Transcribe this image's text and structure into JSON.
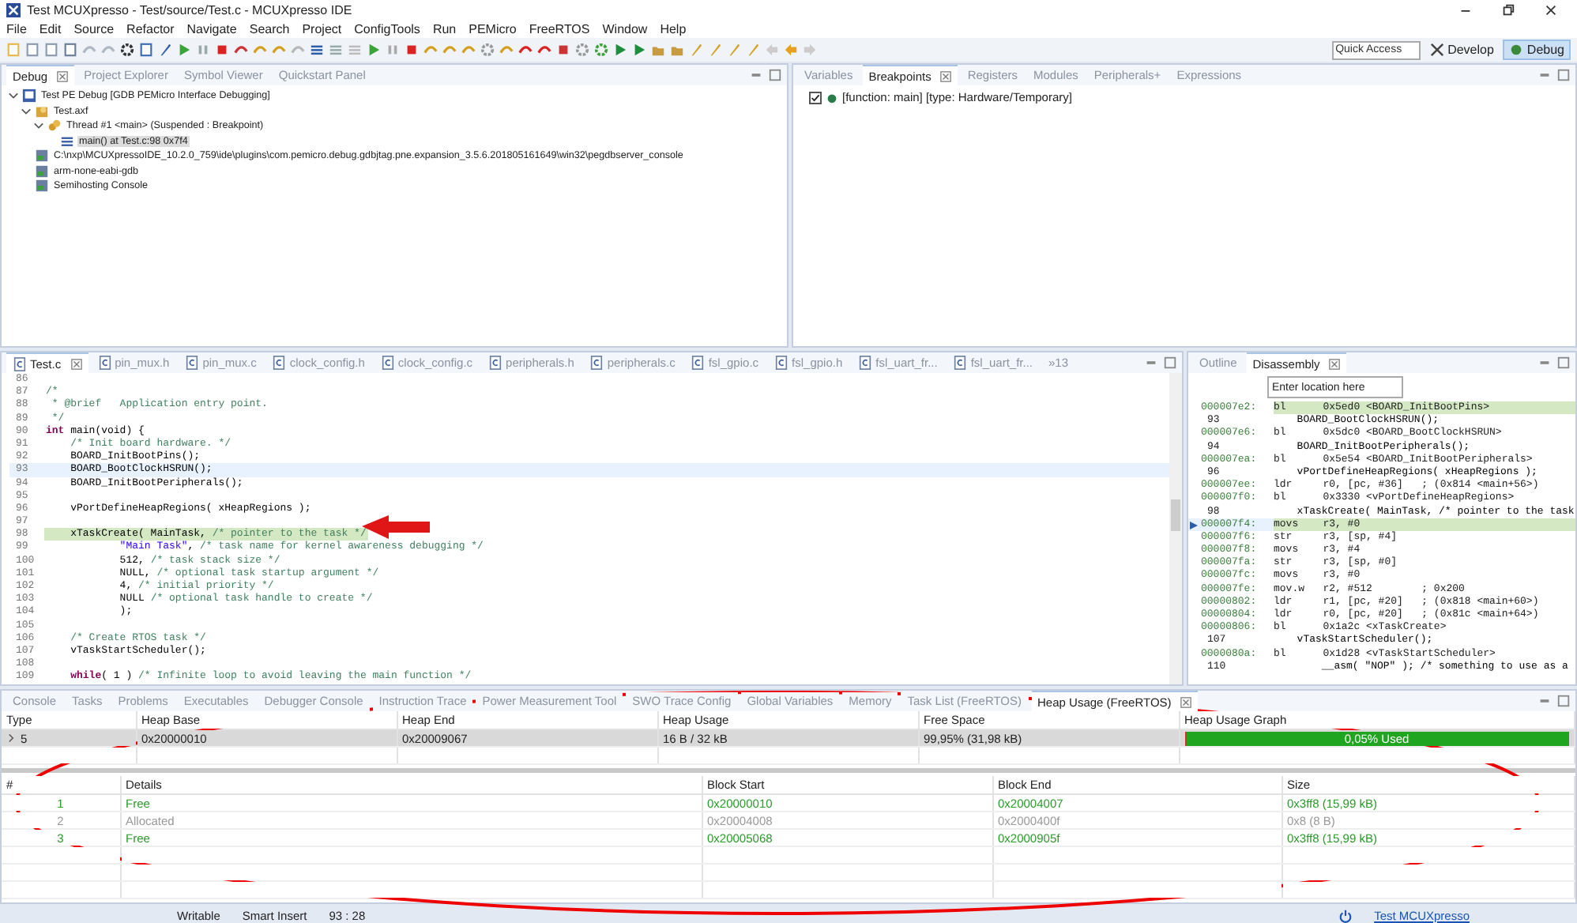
{
  "window": {
    "title": "Test MCUXpresso - Test/source/Test.c - MCUXpresso IDE"
  },
  "menu": [
    "File",
    "Edit",
    "Source",
    "Refactor",
    "Navigate",
    "Search",
    "Project",
    "ConfigTools",
    "Run",
    "PEMicro",
    "FreeRTOS",
    "Window",
    "Help"
  ],
  "toolbar": {
    "quick_access": {
      "placeholder": "Quick Access"
    },
    "perspectives": [
      {
        "label": "Develop",
        "selected": false
      },
      {
        "label": "Debug",
        "selected": true
      }
    ]
  },
  "debug_view": {
    "tabs": [
      {
        "label": "Debug",
        "selected": true
      },
      {
        "label": "Project Explorer",
        "selected": false
      },
      {
        "label": "Symbol Viewer",
        "selected": false
      },
      {
        "label": "Quickstart Panel",
        "selected": false
      }
    ],
    "tree": [
      {
        "label": "Test PE Debug [GDB PEMicro Interface Debugging]",
        "kind": "launch",
        "selected": false,
        "expanded": true,
        "children": [
          {
            "label": "Test.axf",
            "kind": "program",
            "selected": false,
            "expanded": true,
            "children": [
              {
                "label": "Thread #1 <main> (Suspended : Breakpoint)",
                "kind": "thread",
                "selected": false,
                "expanded": true,
                "children": [
                  {
                    "label": "main() at Test.c:98 0x7f4",
                    "kind": "frame",
                    "selected": true
                  }
                ]
              }
            ]
          },
          {
            "label": "C:\\nxp\\MCUXpressoIDE_10.2.0_759\\ide\\plugins\\com.pemicro.debug.gdbjtag.pne.expansion_3.5.6.201805161649\\win32\\pegdbserver_console",
            "kind": "process",
            "selected": false
          },
          {
            "label": "arm-none-eabi-gdb",
            "kind": "process",
            "selected": false
          },
          {
            "label": "Semihosting Console",
            "kind": "process",
            "selected": false
          }
        ]
      }
    ]
  },
  "breakpoints_view": {
    "tabs": [
      {
        "label": "Variables",
        "selected": false
      },
      {
        "label": "Breakpoints",
        "selected": true
      },
      {
        "label": "Registers",
        "selected": false
      },
      {
        "label": "Modules",
        "selected": false
      },
      {
        "label": "Peripherals+",
        "selected": false
      },
      {
        "label": "Expressions",
        "selected": false
      }
    ],
    "breakpoints": [
      {
        "label": "[function: main] [type: Hardware/Temporary]",
        "checked": true
      }
    ]
  },
  "editor": {
    "tabs": [
      {
        "label": "Test.c",
        "selected": true
      },
      {
        "label": "pin_mux.h",
        "selected": false
      },
      {
        "label": "pin_mux.c",
        "selected": false
      },
      {
        "label": "clock_config.h",
        "selected": false
      },
      {
        "label": "clock_config.c",
        "selected": false
      },
      {
        "label": "peripherals.h",
        "selected": false
      },
      {
        "label": "peripherals.c",
        "selected": false
      },
      {
        "label": "fsl_gpio.c",
        "selected": false
      },
      {
        "label": "fsl_gpio.h",
        "selected": false
      },
      {
        "label": "fsl_uart_fr...",
        "selected": false
      },
      {
        "label": "fsl_uart_fr...",
        "selected": false
      }
    ],
    "overflow": "»13",
    "lines": [
      {
        "n": "86"
      },
      {
        "n": "87",
        "parts": [
          {
            "t": "/*",
            "kind": "comment"
          }
        ]
      },
      {
        "n": "88",
        "parts": [
          {
            "t": " * @brief   Application entry point.",
            "kind": "comment"
          }
        ]
      },
      {
        "n": "89",
        "parts": [
          {
            "t": " */",
            "kind": "comment"
          }
        ]
      },
      {
        "n": "90",
        "parts": [
          {
            "t": "int",
            "kind": "keyword"
          },
          {
            "t": " main(void) {",
            "kind": "plain"
          }
        ]
      },
      {
        "n": "91",
        "parts": [
          {
            "t": "    /* Init board hardware. */",
            "kind": "comment"
          }
        ]
      },
      {
        "n": "92",
        "parts": [
          {
            "t": "    BOARD_InitBootPins();",
            "kind": "plain"
          }
        ]
      },
      {
        "n": "93",
        "caret": true,
        "parts": [
          {
            "t": "    BOARD_BootClockHSRUN();",
            "kind": "plain"
          }
        ]
      },
      {
        "n": "94",
        "parts": [
          {
            "t": "    BOARD_InitBootPeripherals();",
            "kind": "plain"
          }
        ]
      },
      {
        "n": "95"
      },
      {
        "n": "96",
        "parts": [
          {
            "t": "    vPortDefineHeapRegions( xHeapRegions );",
            "kind": "plain"
          }
        ]
      },
      {
        "n": "97"
      },
      {
        "n": "98",
        "current": true,
        "parts": [
          {
            "t": "    xTaskCreate( MainTask, ",
            "kind": "plain"
          },
          {
            "t": "/* pointer to the task */",
            "kind": "comment"
          }
        ]
      },
      {
        "n": "99",
        "parts": [
          {
            "t": "            \"Main Task\"",
            "kind": "string"
          },
          {
            "t": ", ",
            "kind": "plain"
          },
          {
            "t": "/* task name for kernel awareness debugging */",
            "kind": "comment"
          }
        ]
      },
      {
        "n": "100",
        "parts": [
          {
            "t": "            512, ",
            "kind": "plain"
          },
          {
            "t": "/* task stack size */",
            "kind": "comment"
          }
        ]
      },
      {
        "n": "101",
        "parts": [
          {
            "t": "            NULL, ",
            "kind": "plain"
          },
          {
            "t": "/* optional task startup argument */",
            "kind": "comment"
          }
        ]
      },
      {
        "n": "102",
        "parts": [
          {
            "t": "            4, ",
            "kind": "plain"
          },
          {
            "t": "/* initial priority */",
            "kind": "comment"
          }
        ]
      },
      {
        "n": "103",
        "parts": [
          {
            "t": "            NULL ",
            "kind": "plain"
          },
          {
            "t": "/* optional task handle to create */",
            "kind": "comment"
          }
        ]
      },
      {
        "n": "104",
        "parts": [
          {
            "t": "            );",
            "kind": "plain"
          }
        ]
      },
      {
        "n": "105"
      },
      {
        "n": "106",
        "parts": [
          {
            "t": "    /* Create RTOS task */",
            "kind": "comment"
          }
        ]
      },
      {
        "n": "107",
        "parts": [
          {
            "t": "    vTaskStartScheduler();",
            "kind": "plain"
          }
        ]
      },
      {
        "n": "108"
      },
      {
        "n": "109",
        "parts": [
          {
            "t": "    while",
            "kind": "keyword"
          },
          {
            "t": "( 1 ) ",
            "kind": "plain"
          },
          {
            "t": "/* Infinite loop to avoid leaving the main function */",
            "kind": "comment"
          }
        ]
      }
    ]
  },
  "disassembly_view": {
    "tabs": [
      {
        "label": "Outline",
        "selected": false
      },
      {
        "label": "Disassembly",
        "selected": true
      }
    ],
    "location": {
      "placeholder": "Enter location here"
    },
    "lines": [
      {
        "kind": "asm",
        "addr": "000007e2:",
        "text": "bl      0x5ed0 <BOARD_InitBootPins>",
        "highlight": true
      },
      {
        "kind": "src",
        "addr": "93",
        "text": "  BOARD_BootClockHSRUN();"
      },
      {
        "kind": "asm",
        "addr": "000007e6:",
        "text": "bl      0x5dc0 <BOARD_BootClockHSRUN>"
      },
      {
        "kind": "src",
        "addr": "94",
        "text": "  BOARD_InitBootPeripherals();"
      },
      {
        "kind": "asm",
        "addr": "000007ea:",
        "text": "bl      0x5e54 <BOARD_InitBootPeripherals>"
      },
      {
        "kind": "src",
        "addr": "96",
        "text": "  vPortDefineHeapRegions( xHeapRegions );"
      },
      {
        "kind": "asm",
        "addr": "000007ee:",
        "text": "ldr     r0, [pc, #36]   ; (0x814 <main+56>)"
      },
      {
        "kind": "asm",
        "addr": "000007f0:",
        "text": "bl      0x3330 <vPortDefineHeapRegions>"
      },
      {
        "kind": "src",
        "addr": "98",
        "text": "  xTaskCreate( MainTask, /* pointer to the task"
      },
      {
        "kind": "asm",
        "addr": "000007f4:",
        "text": "movs    r3, #0",
        "highlight": true,
        "current": true
      },
      {
        "kind": "asm",
        "addr": "000007f6:",
        "text": "str     r3, [sp, #4]"
      },
      {
        "kind": "asm",
        "addr": "000007f8:",
        "text": "movs    r3, #4"
      },
      {
        "kind": "asm",
        "addr": "000007fa:",
        "text": "str     r3, [sp, #0]"
      },
      {
        "kind": "asm",
        "addr": "000007fc:",
        "text": "movs    r3, #0"
      },
      {
        "kind": "asm",
        "addr": "000007fe:",
        "text": "mov.w   r2, #512        ; 0x200"
      },
      {
        "kind": "asm",
        "addr": "00000802:",
        "text": "ldr     r1, [pc, #20]   ; (0x818 <main+60>)"
      },
      {
        "kind": "asm",
        "addr": "00000804:",
        "text": "ldr     r0, [pc, #20]   ; (0x81c <main+64>)"
      },
      {
        "kind": "asm",
        "addr": "00000806:",
        "text": "bl      0x1a2c <xTaskCreate>"
      },
      {
        "kind": "src",
        "addr": "107",
        "text": "  vTaskStartScheduler();"
      },
      {
        "kind": "asm",
        "addr": "0000080a:",
        "text": "bl      0x1d28 <vTaskStartScheduler>"
      },
      {
        "kind": "src",
        "addr": "110",
        "text": "      __asm( \"NOP\" ); /* something to use as a"
      }
    ]
  },
  "bottom_panel": {
    "tabs": [
      {
        "label": "Console",
        "selected": false
      },
      {
        "label": "Tasks",
        "selected": false
      },
      {
        "label": "Problems",
        "selected": false
      },
      {
        "label": "Executables",
        "selected": false
      },
      {
        "label": "Debugger Console",
        "selected": false
      },
      {
        "label": "Instruction Trace",
        "selected": false
      },
      {
        "label": "Power Measurement Tool",
        "selected": false
      },
      {
        "label": "SWO Trace Config",
        "selected": false
      },
      {
        "label": "Global Variables",
        "selected": false
      },
      {
        "label": "Memory",
        "selected": false
      },
      {
        "label": "Task List (FreeRTOS)",
        "selected": false
      },
      {
        "label": "Heap Usage (FreeRTOS)",
        "selected": true
      }
    ],
    "heap_table": {
      "columns": [
        "Type",
        "Heap Base",
        "Heap End",
        "Heap Usage",
        "Free Space",
        "Heap Usage Graph"
      ],
      "rows": [
        {
          "type": "5",
          "heap_base": "0x20000010",
          "heap_end": "0x20009067",
          "heap_usage": "16 B / 32 kB",
          "free_space": "99,95% (31,98 kB)",
          "level": 0.0005,
          "graph_label": "0,05% Used"
        }
      ]
    },
    "block_table": {
      "columns": [
        "#",
        "Details",
        "Block Start",
        "Block End",
        "Size"
      ],
      "rows": [
        {
          "index": "1",
          "details": "Free",
          "start": "0x20000010",
          "end": "0x20004007",
          "size": "0x3ff8 (15,99 kB)",
          "allocated": false
        },
        {
          "index": "2",
          "details": "Allocated",
          "start": "0x20004008",
          "end": "0x2000400f",
          "size": "0x8 (8 B)",
          "allocated": true
        },
        {
          "index": "3",
          "details": "Free",
          "start": "0x20005068",
          "end": "0x2000905f",
          "size": "0x3ff8 (15,99 kB)",
          "allocated": false
        }
      ]
    }
  },
  "status_bar": {
    "items": [
      "Writable",
      "Smart Insert",
      "93 : 28"
    ],
    "link": "Test MCUXpresso"
  }
}
